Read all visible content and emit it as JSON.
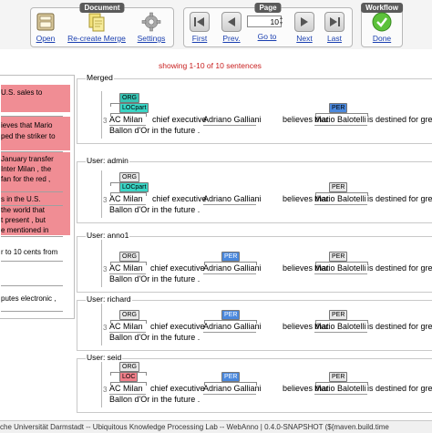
{
  "colors": {
    "org": "#37c4b4",
    "locpart": "#39d6c6",
    "per": "#4a88dd",
    "loc": "#f07f8a",
    "neutral": "#e8e8e8",
    "status": "#c81e1e",
    "highlight": "#f08d94"
  },
  "toolbar": {
    "document": {
      "title": "Document",
      "open": "Open",
      "recreate": "Re-create Merge",
      "settings": "Settings"
    },
    "page": {
      "title": "Page",
      "first": "First",
      "prev": "Prev.",
      "page_value": "10",
      "goto": "Go to",
      "next": "Next",
      "last": "Last"
    },
    "workflow": {
      "title": "Workflow",
      "done": "Done"
    }
  },
  "status_text": "showing 1-10 of 10 sentences",
  "left_panel": {
    "lines": [
      {
        "text": "U.S. sales to",
        "highlight": true
      },
      {
        "text": "",
        "highlight": true
      },
      {
        "text": "ieves that Mario",
        "highlight": true
      },
      {
        "text": "ped the striker to",
        "highlight": true
      },
      {
        "text": "",
        "highlight": true
      },
      {
        "text": "January transfer",
        "highlight": true
      },
      {
        "text": "Inter Milan , the",
        "highlight": true
      },
      {
        "text": "fan for the red ,",
        "highlight": true
      },
      {
        "text": "",
        "highlight": true
      },
      {
        "text": "s in the U.S.",
        "highlight": true
      },
      {
        "text": "the world that",
        "highlight": true
      },
      {
        "text": "t present , but",
        "highlight": true
      },
      {
        "text": "e mentioned in",
        "highlight": true
      },
      {
        "text": "r to 10 cents from",
        "highlight": false
      },
      {
        "text": "",
        "highlight": false
      },
      {
        "text": "",
        "highlight": false
      },
      {
        "text": "putes electronic ,",
        "highlight": false
      }
    ]
  },
  "sentence": {
    "number": "3",
    "line2": "Ballon d'Or in the future .",
    "tokens": {
      "ac_milan": "AC Milan",
      "chief_exec": "chief executive",
      "galliani": "Adriano Galliani",
      "believes": "believes that",
      "balotelli": "Mario Balotelli",
      "destined": "is destined for great"
    }
  },
  "panels": [
    {
      "title": "Merged",
      "tags": {
        "org": "ORG",
        "loc": "LOCpart",
        "loc_type": "locpart",
        "per1": "",
        "per2": "PER",
        "per2_type": "per"
      }
    },
    {
      "title": "User: admin",
      "tags": {
        "org": "ORG",
        "loc": "LOCpart",
        "loc_type": "locpart",
        "per1": "",
        "per2": "PER",
        "per2_type": "neutral"
      }
    },
    {
      "title": "User: anno1",
      "tags": {
        "org": "ORG",
        "loc": "",
        "loc_type": "none",
        "per1": "PER",
        "per2": "PER",
        "per2_type": "neutral"
      }
    },
    {
      "title": "User: richard",
      "tags": {
        "org": "ORG",
        "loc": "",
        "loc_type": "none",
        "per1": "PER",
        "per2": "PER",
        "per2_type": "neutral"
      }
    },
    {
      "title": "User: seid",
      "tags": {
        "org": "ORG",
        "loc": "LOC",
        "loc_type": "loc",
        "per1": "PER",
        "per2": "PER",
        "per2_type": "neutral"
      }
    }
  ],
  "footer": "che Universität Darmstadt -- Ubiquitous Knowledge Processing Lab -- WebAnno | 0.4.0-SNAPSHOT (${maven.build.time"
}
